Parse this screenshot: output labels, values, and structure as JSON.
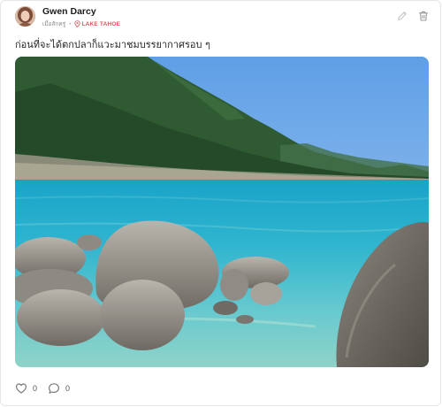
{
  "post": {
    "author_name": "Gwen Darcy",
    "time_text": "เมื่อสักครู่",
    "location": "LAKE TAHOE",
    "caption": "ก่อนที่จะได้ตกปลาก็แวะมาชมบรรยากาศรอบ ๆ",
    "likes_count": "0",
    "comments_count": "0"
  },
  "icons": {
    "edit": "pencil-icon",
    "delete": "trash-icon",
    "location": "map-pin-icon",
    "like": "heart-icon",
    "comment": "comment-bubble-icon"
  },
  "colors": {
    "location_accent": "#e0545a",
    "icon_gray": "#9a9a9a"
  }
}
